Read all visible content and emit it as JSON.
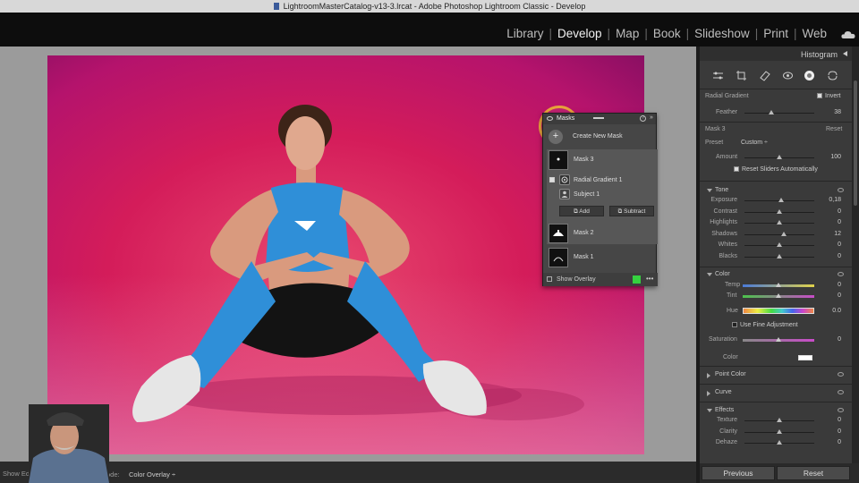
{
  "window": {
    "title": "LightroomMasterCatalog-v13-3.lrcat - Adobe Photoshop Lightroom Classic - Develop"
  },
  "modules": [
    {
      "label": "Library",
      "active": false
    },
    {
      "label": "Develop",
      "active": true
    },
    {
      "label": "Map",
      "active": false
    },
    {
      "label": "Slideshow",
      "active": false
    },
    {
      "label": "Book",
      "active": false
    },
    {
      "label": "Print",
      "active": false
    },
    {
      "label": "Web",
      "active": false
    }
  ],
  "toolbar": {
    "show_edit": "Show Ed",
    "mode_label": "ode:",
    "mode_value": "Color Overlay",
    "mode_arrow": "÷"
  },
  "masks_panel": {
    "title": "Masks",
    "create_new": "Create New Mask",
    "plus": "+",
    "masks": [
      {
        "name": "Mask 3",
        "selected": true
      },
      {
        "name": "Mask 2",
        "selected": false
      },
      {
        "name": "Mask 1",
        "selected": false
      }
    ],
    "components": [
      {
        "name": "Radial Gradient 1"
      },
      {
        "name": "Subject 1"
      }
    ],
    "add_label": "Add",
    "subtract_label": "Subtract",
    "show_overlay": "Show Overlay",
    "overlay_color": "#35d23f",
    "more": "•••",
    "help": "?",
    "expand": "»"
  },
  "right_panel": {
    "histogram_label": "Histogram",
    "tool_icons": [
      "sliders-icon",
      "crop-icon",
      "eraser-icon",
      "redeye-icon",
      "masking-icon",
      "presets-icon"
    ],
    "radial_gradient": {
      "label": "Radial Gradient",
      "invert_label": "Invert",
      "invert_checked": true,
      "feather_label": "Feather",
      "feather_value": "38",
      "feather_pos": 0.38
    },
    "mask": {
      "label": "Mask 3",
      "reset_label": "Reset",
      "preset_label": "Preset",
      "preset_value": "Custom ÷",
      "amount_label": "Amount",
      "amount_value": "100",
      "amount_pos": 0.5,
      "reset_sliders": "Reset Sliders Automatically"
    },
    "tone": {
      "title": "Tone",
      "rows": [
        {
          "label": "Exposure",
          "value": "0,18",
          "pos": 0.52
        },
        {
          "label": "Contrast",
          "value": "0",
          "pos": 0.5
        },
        {
          "label": "Highlights",
          "value": "0",
          "pos": 0.5
        },
        {
          "label": "Shadows",
          "value": "12",
          "pos": 0.56
        },
        {
          "label": "Whites",
          "value": "0",
          "pos": 0.5
        },
        {
          "label": "Blacks",
          "value": "0",
          "pos": 0.5
        }
      ]
    },
    "color": {
      "title": "Color",
      "temp_label": "Temp",
      "temp_value": "0",
      "tint_label": "Tint",
      "tint_value": "0",
      "hue_label": "Hue",
      "hue_value": "0.0",
      "fine_adjust": "Use Fine Adjustment",
      "saturation_label": "Saturation",
      "saturation_value": "0",
      "color_label": "Color"
    },
    "point_color": {
      "title": "Point Color"
    },
    "curve": {
      "title": "Curve"
    },
    "effects": {
      "title": "Effects",
      "rows": [
        {
          "label": "Texture",
          "value": "0",
          "pos": 0.5
        },
        {
          "label": "Clarity",
          "value": "0",
          "pos": 0.5
        },
        {
          "label": "Dehaze",
          "value": "0",
          "pos": 0.5
        }
      ]
    },
    "previous_label": "Previous",
    "reset_label": "Reset"
  }
}
